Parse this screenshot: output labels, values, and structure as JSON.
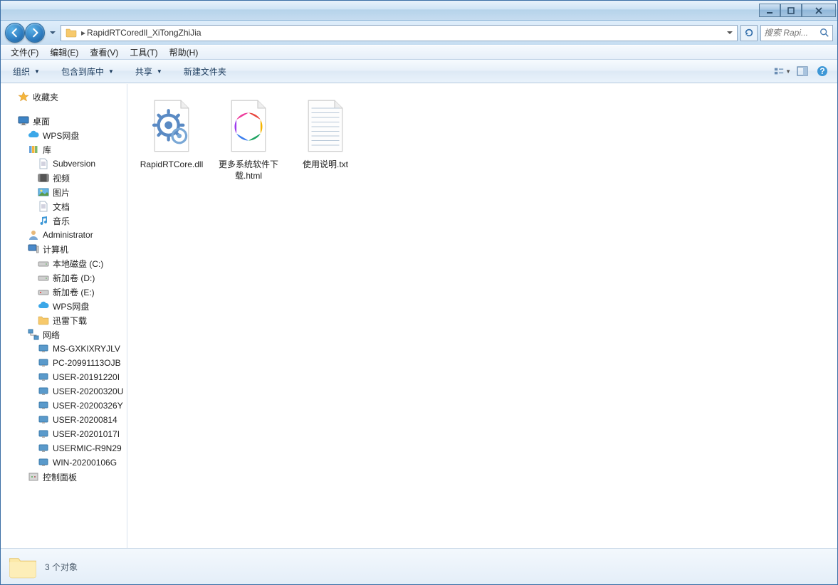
{
  "address": {
    "path_label": "RapidRTCoredll_XiTongZhiJia"
  },
  "search": {
    "placeholder": "搜索 Rapi..."
  },
  "menubar": {
    "file": "文件(F)",
    "edit": "编辑(E)",
    "view": "查看(V)",
    "tools": "工具(T)",
    "help": "帮助(H)"
  },
  "toolbar": {
    "organize": "组织",
    "include": "包含到库中",
    "share": "共享",
    "newfolder": "新建文件夹"
  },
  "tree": {
    "favorites": "收藏夹",
    "desktop": "桌面",
    "wps": "WPS网盘",
    "libraries": "库",
    "subversion": "Subversion",
    "videos": "视频",
    "pictures": "图片",
    "documents": "文档",
    "music": "音乐",
    "admin": "Administrator",
    "computer": "计算机",
    "diskC": "本地磁盘 (C:)",
    "diskD": "新加卷 (D:)",
    "diskE": "新加卷 (E:)",
    "wps2": "WPS网盘",
    "xunlei": "迅雷下载",
    "network": "网络",
    "pc1": "MS-GXKIXRYJLV",
    "pc2": "PC-20991113OJB",
    "pc3": "USER-20191220I",
    "pc4": "USER-20200320U",
    "pc5": "USER-20200326Y",
    "pc6": "USER-20200814",
    "pc7": "USER-20201017I",
    "pc8": "USERMIC-R9N29",
    "pc9": "WIN-20200106G",
    "cpanel": "控制面板"
  },
  "files": {
    "f1": "RapidRTCore.dll",
    "f2": "更多系统软件下载.html",
    "f3": "使用说明.txt"
  },
  "status": {
    "count": "3 个对象"
  }
}
